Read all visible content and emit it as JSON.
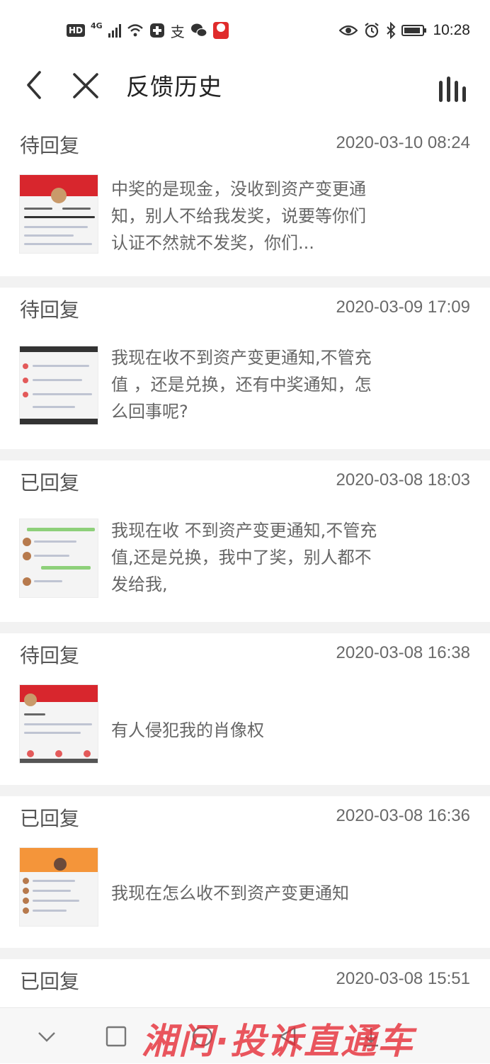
{
  "status_bar": {
    "hd": "HD",
    "network": "4G",
    "time": "10:28",
    "battery_level": 0.9,
    "icons": [
      "signal-icon",
      "wifi-icon",
      "plus-app-icon",
      "alipay-icon",
      "wechat-icon",
      "red-app-icon",
      "eye-icon",
      "alarm-icon",
      "bluetooth-icon",
      "battery-icon"
    ]
  },
  "nav": {
    "title": "反馈历史",
    "back_icon": "chevron-left-icon",
    "close_icon": "close-icon",
    "menu_icon": "bars-icon"
  },
  "items": [
    {
      "status": "待回复",
      "time": "2020-03-10 08:24",
      "text": "中奖的是现金，没收到资产变更通知，别人不给我发奖，说要等你们认证不然就不发奖，你们..."
    },
    {
      "status": "待回复",
      "time": "2020-03-09 17:09",
      "text": "我现在收不到资产变更通知,不管充值 ，还是兑换，还有中奖通知，怎么回事呢?"
    },
    {
      "status": "已回复",
      "time": "2020-03-08 18:03",
      "text": "我现在收 不到资产变更通知,不管充值,还是兑换，我中了奖，别人都不发给我,"
    },
    {
      "status": "待回复",
      "time": "2020-03-08 16:38",
      "text": "有人侵犯我的肖像权"
    },
    {
      "status": "已回复",
      "time": "2020-03-08 16:36",
      "text": "我现在怎么收不到资产变更通知"
    },
    {
      "status": "已回复",
      "time": "2020-03-08 15:51",
      "text": ""
    }
  ],
  "bottom_nav": {
    "icons": [
      "chevron-down-icon",
      "square-icon",
      "circle-icon",
      "triangle-back-icon",
      "download-icon"
    ],
    "watermark": "湘问·投诉直通车"
  },
  "colors": {
    "accent_red": "#e02b2b",
    "divider": "#f2f2f2",
    "text_secondary": "#666666"
  }
}
